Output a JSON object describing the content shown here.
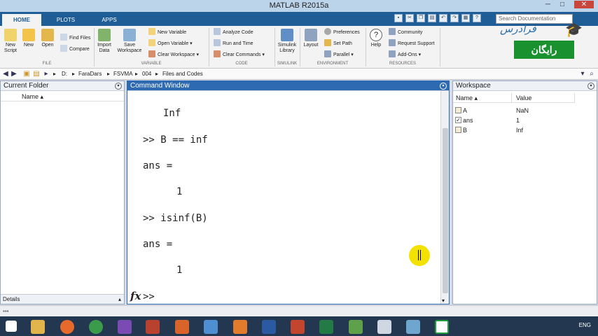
{
  "window": {
    "title": "MATLAB R2015a"
  },
  "tabs": [
    {
      "label": "HOME"
    },
    {
      "label": "PLOTS"
    },
    {
      "label": "APPS"
    }
  ],
  "search": {
    "placeholder": "Search Documentation"
  },
  "ribbon": {
    "file": {
      "group": "FILE",
      "new_script": "New Script",
      "new": "New",
      "open": "Open",
      "find_files": "Find Files",
      "compare": "Compare"
    },
    "variable": {
      "group": "VARIABLE",
      "import_data": "Import Data",
      "save_workspace": "Save Workspace",
      "new_variable": "New Variable",
      "open_variable": "Open Variable",
      "clear_workspace": "Clear Workspace"
    },
    "code": {
      "group": "CODE",
      "analyze_code": "Analyze Code",
      "run_and_time": "Run and Time",
      "clear_commands": "Clear Commands"
    },
    "simulink": {
      "group": "SIMULINK",
      "simulink_library": "Simulink Library"
    },
    "environment": {
      "group": "ENVIRONMENT",
      "layout": "Layout",
      "preferences": "Preferences",
      "set_path": "Set Path",
      "parallel": "Parallel"
    },
    "resources": {
      "group": "RESOURCES",
      "help": "Help",
      "community": "Community",
      "request_support": "Request Support",
      "add_ons": "Add-Ons"
    }
  },
  "logo": {
    "name": "فرادرس",
    "badge": "رایگان"
  },
  "path": {
    "segments": [
      "D:",
      "FaraDars",
      "FSVMA",
      "004",
      "Files and Codes"
    ]
  },
  "current_folder": {
    "title": "Current Folder",
    "column": "Name",
    "footer": "Details"
  },
  "command_window": {
    "title": "Command Window",
    "lines": [
      "Inf",
      ">> B == inf",
      "ans =",
      "1",
      ">> isinf(B)",
      "ans =",
      "1"
    ],
    "prompt": ">>",
    "fx": "fx"
  },
  "workspace": {
    "title": "Workspace",
    "col_name": "Name",
    "col_value": "Value",
    "rows": [
      {
        "name": "A",
        "value": "NaN",
        "icon": "matrix-icon"
      },
      {
        "name": "ans",
        "value": "1",
        "icon": "logical-icon"
      },
      {
        "name": "B",
        "value": "Inf",
        "icon": "matrix-icon"
      }
    ]
  },
  "taskbar": {
    "lang": "ENG"
  }
}
